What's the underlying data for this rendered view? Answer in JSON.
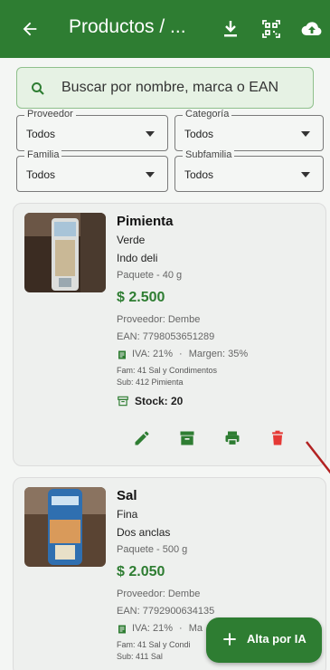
{
  "appbar": {
    "title": "Productos / ...",
    "color": "#2e7d32"
  },
  "search": {
    "placeholder": "Buscar por nombre, marca o EAN"
  },
  "filters": [
    {
      "label": "Proveedor",
      "value": "Todos"
    },
    {
      "label": "Categoría",
      "value": "Todos"
    },
    {
      "label": "Familia",
      "value": "Todos"
    },
    {
      "label": "Subfamilia",
      "value": "Todos"
    }
  ],
  "products": [
    {
      "name": "Pimienta",
      "variant": "Verde",
      "brand": "Indo deli",
      "package": "Paquete - 40 g",
      "price": "$ 2.500",
      "provider": "Proveedor: Dembe",
      "ean": "EAN: 7798053651289",
      "iva": "IVA: 21%",
      "sep": "·",
      "margin": "Margen: 35%",
      "fam": "Fam: 41 Sal y Condimentos",
      "sub": "Sub: 412 Pimienta",
      "stock": "Stock: 20"
    },
    {
      "name": "Sal",
      "variant": "Fina",
      "brand": "Dos anclas",
      "package": "Paquete - 500 g",
      "price": "$ 2.050",
      "provider": "Proveedor: Dembe",
      "ean": "EAN: 7792900634135",
      "iva": "IVA: 21%",
      "sep": "·",
      "margin": "Ma",
      "fam": "Fam: 41 Sal y Condi",
      "sub": "Sub: 411 Sal"
    }
  ],
  "fab": {
    "label": "Alta por IA"
  },
  "colors": {
    "primary": "#2e7d32",
    "delete": "#e53935"
  }
}
